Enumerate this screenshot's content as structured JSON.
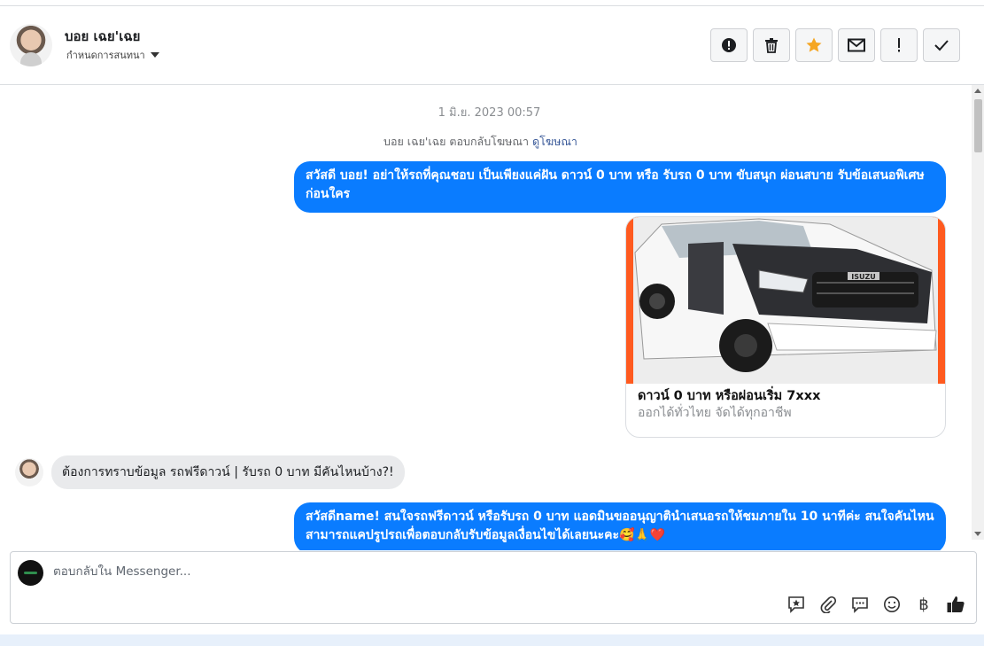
{
  "header": {
    "contact_name": "บอย เฉย'เฉย",
    "assign_label": "กำหนดการสนทนา",
    "actions": [
      {
        "name": "report-button",
        "icon": "alert-circle-icon"
      },
      {
        "name": "delete-button",
        "icon": "trash-icon"
      },
      {
        "name": "star-button",
        "icon": "star-icon"
      },
      {
        "name": "mark-unread-button",
        "icon": "envelope-icon"
      },
      {
        "name": "important-button",
        "icon": "exclamation-icon"
      },
      {
        "name": "done-button",
        "icon": "check-icon"
      }
    ],
    "star_color": "#f5a623"
  },
  "chat": {
    "timestamp": "1 มิ.ย. 2023 00:57",
    "ad_reply_text": "บอย เฉย'เฉย ตอบกลับโฆษณา",
    "ad_reply_link": "ดูโฆษณา",
    "messages": {
      "outgoing_1": "สวัสดี บอย! อย่าให้รถที่คุณชอบ เป็นเพียงแค่ฝัน ดาวน์ 0 บาท หรือ รับรถ 0 บาท ขับสนุก ผ่อนสบาย รับข้อเสนอพิเศษก่อนใคร",
      "card_title": "ดาวน์ 0 บาท หรือผ่อนเริ่ม 7xxx",
      "card_subtitle": "ออกได้ทั่วไทย จัดได้ทุกอาชีพ",
      "card_brand": "ISUZU",
      "incoming_1": "ต้องการทราบข้อมูล รถฟรีดาวน์ | รับรถ 0 บาท มีคันไหนบ้าง?!",
      "outgoing_2": "สวัสดีname! สนใจรถฟรีดาวน์ หรือรับรถ 0 บาท แอดมินขออนุญาตินำเสนอรถให้ชมภายใน 10 นาทีค่ะ สนใจคันไหนสามารถแคปรูปรถเพื่อตอบกลับรับข้อมูลเงื่อนไขได้เลยนะคะ🥰🙏❤️"
    },
    "bubble_color": "#0a7cff"
  },
  "composer": {
    "placeholder": "ตอบกลับใน Messenger...",
    "tools": [
      "saved-reply-icon",
      "attachment-icon",
      "chat-bubble-icon",
      "emoji-icon",
      "baht-icon",
      "thumbs-up-icon"
    ],
    "baht_symbol": "฿"
  }
}
